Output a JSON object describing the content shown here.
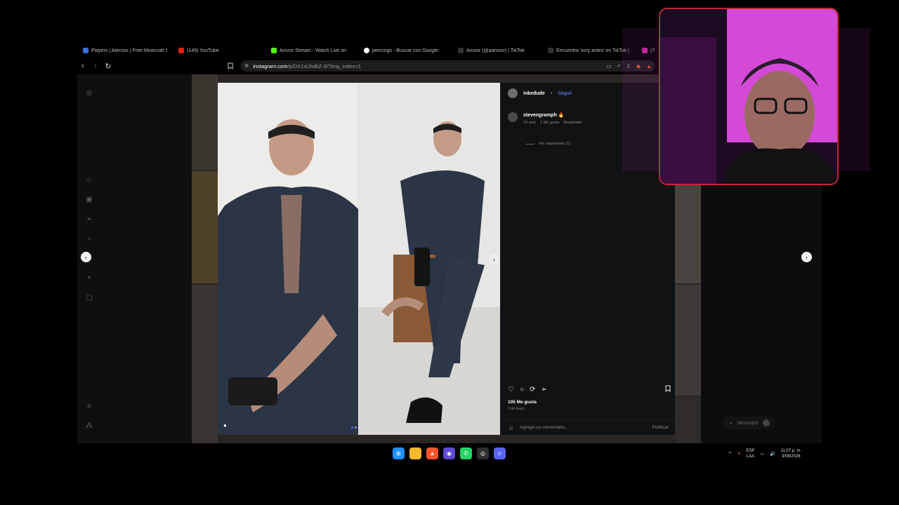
{
  "browser": {
    "tabs": [
      {
        "label": "Players | Aternos | Free Minecraft S",
        "color": "#3b6fd9"
      },
      {
        "label": "(149) YouTube",
        "color": "#e62117"
      },
      {
        "label": "",
        "color": "#000000"
      },
      {
        "label": "Amzor Stream - Watch Live on",
        "color": "#53fc18"
      },
      {
        "label": "piercings - Buscar con Google",
        "color": "#ffffff"
      },
      {
        "label": "Amzor (@aamzor) | TikTok",
        "color": "#222222"
      },
      {
        "label": "Encuentra 'xcry antes' en TikTok |",
        "color": "#222222"
      },
      {
        "label": "(7) I",
        "color": "#d6249f"
      }
    ],
    "url_host": "instagram.com",
    "url_path": "/p/DX1xUhdkZ-9/?img_index=1",
    "back_icon": "‹",
    "forward_icon": "›",
    "reload_icon": "↻"
  },
  "instagram": {
    "post_author": "inkedude",
    "separator": "•",
    "follow_label": "Seguir",
    "comment": {
      "user": "stevengramph",
      "emoji": "🔥",
      "time": "13 sem",
      "likes": "1 Me gusta",
      "reply": "Responder"
    },
    "view_replies": "Ver respuestas (1)",
    "likes_count": "105 Me gusta",
    "post_date": "2 de mayo",
    "comment_placeholder": "Agrega un comentario...",
    "publish_label": "Publicar",
    "messages_label": "Mensajes"
  },
  "taskbar": {
    "lang_top": "ESP",
    "lang_bottom": "LAA",
    "time": "11:07 p. m.",
    "date": "3/08/2026"
  }
}
